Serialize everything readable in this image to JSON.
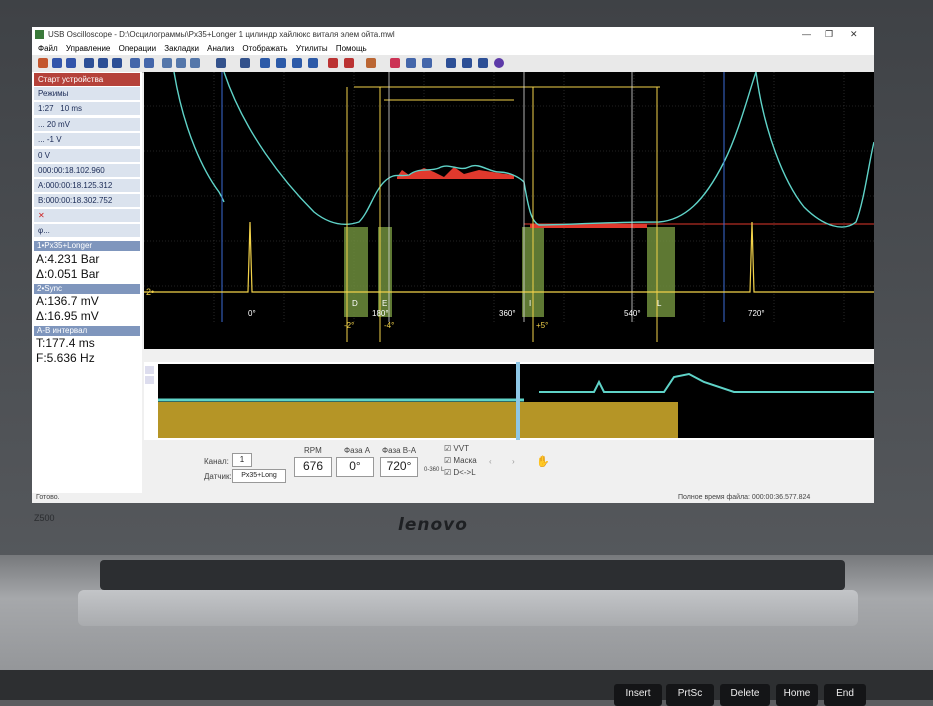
{
  "window": {
    "title": "USB Oscilloscope - D:\\Осцилограммы\\Px35+Longer 1 цилиндр хайлюкс виталя элем ойта.mwl",
    "minimize": "—",
    "maximize": "❐",
    "close": "✕"
  },
  "menu": [
    "Файл",
    "Управление",
    "Операции",
    "Закладки",
    "Анализ",
    "Отображать",
    "Утилиты",
    "Помощь"
  ],
  "sidebar": {
    "start_button": "Старт устройства",
    "modes": "Режимы",
    "timebase": "1:27",
    "timebase_value": "10 ms",
    "ch1_scale": "... 20 mV",
    "ch2_scale": "... -1 V",
    "trigger_level": "0 V",
    "time_cursor": "000:00:18.102.960",
    "cursor_a": "000:00:18.125.312",
    "cursor_b": "000:00:18.302.752",
    "ch1_header": "1•Px35+Longer",
    "ch1_a": "A:4.231 Bar",
    "ch1_delta": "Δ:0.051 Bar",
    "ch2_header": "2•Sync",
    "ch2_a": "A:136.7 mV",
    "ch2_delta": "Δ:16.95 mV",
    "ab_header": "A-B интервал",
    "ab_t": "T:177.4 ms",
    "ab_f": "F:5.636 Hz"
  },
  "plot": {
    "phase_labels": [
      "0°",
      "180°",
      "360°",
      "540°",
      "720°"
    ],
    "marker_letters": [
      "D",
      "E",
      "I",
      "L"
    ],
    "offset_labels": [
      "-2°",
      "-4°",
      "+5°"
    ],
    "ch2_marker": "2•",
    "colors": {
      "trace": "#5fd3c8",
      "sync": "#f2d24a",
      "grid": "#3a3a3a",
      "background": "#000000",
      "red": "#e0392d",
      "green": "#6e8d3c"
    }
  },
  "control_panel": {
    "channel_label": "Канал:",
    "channel_value": "1",
    "sensor_label": "Датчик:",
    "sensor_value": "Px35+Long",
    "rpm_label": "RPM",
    "rpm_value": "676",
    "phase_a_label": "Фаза A",
    "phase_a_value": "0°",
    "phase_ba_label": "Фаза B-A",
    "phase_ba_value": "720°",
    "scale_label": "0-360 L",
    "vvt_label": "VVT",
    "mask_label": "Маска",
    "dl_label": "D<->L"
  },
  "status": {
    "ready": "Готово.",
    "file_time": "Полное время файла: 000:00:36.577.824"
  },
  "bezel": {
    "brand": "lenovo",
    "model": "Z500"
  },
  "keys": [
    "Delete",
    "Home",
    "End",
    "Insert",
    "PrtSc"
  ]
}
